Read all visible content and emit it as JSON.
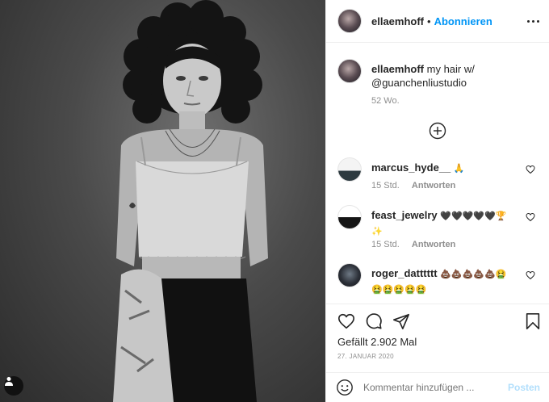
{
  "post": {
    "username": "ellaemhoff",
    "follow_label": "Abonnieren",
    "caption_user": "ellaemhoff",
    "caption_text": "my hair w/",
    "caption_mention": "@guanchenliustudio",
    "caption_age": "52 Wo."
  },
  "comments": [
    {
      "user": "marcus_hyde__",
      "text": "🙏",
      "time": "15 Std.",
      "reply_label": "Antworten"
    },
    {
      "user": "feast_jewelry",
      "text": "🖤🖤🖤🖤🖤🏆",
      "text2": "✨",
      "time": "15 Std.",
      "reply_label": "Antworten"
    },
    {
      "user": "roger_datttttt",
      "text": "💩💩💩💩💩🤮",
      "text2": "🤮🤮🤮🤮🤮"
    }
  ],
  "actions": {
    "likes": "Gefällt 2.902 Mal",
    "date": "27. JANUAR 2020"
  },
  "add_comment": {
    "placeholder": "Kommentar hinzufügen ...",
    "post_label": "Posten"
  },
  "icons": {
    "more": "more-options-icon",
    "plus": "plus-circle-icon",
    "heart": "heart-icon",
    "comment": "comment-icon",
    "share": "share-icon",
    "save": "bookmark-icon",
    "emoji": "emoji-icon",
    "tag": "user-tag-icon"
  }
}
